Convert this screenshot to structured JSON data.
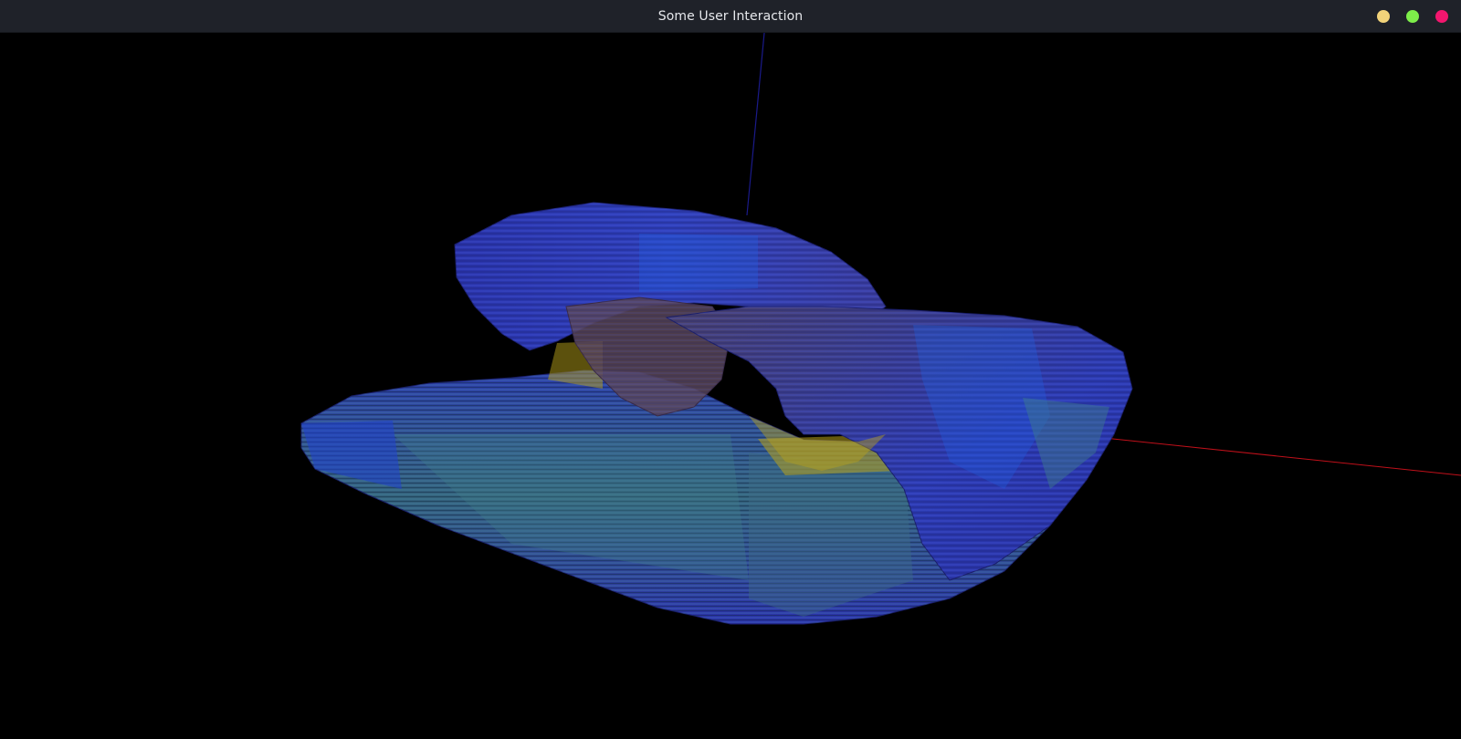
{
  "window": {
    "title": "Some User Interaction",
    "controls": {
      "minimize": {
        "color": "#f2d37a"
      },
      "maximize": {
        "color": "#7dee4a"
      },
      "close": {
        "color": "#f2166e"
      }
    }
  },
  "scene": {
    "background": "#000000",
    "object": "wireframe-3d-mesh",
    "colors": {
      "mesh_blue": "#2a2fa8",
      "mesh_bright_blue": "#1f5fe0",
      "mesh_teal": "#3e7f8a",
      "mesh_brown": "#5a4658",
      "mesh_yellow": "#b8a21a",
      "axis_x": "#c0101a",
      "axis_z": "#1a1a8a"
    }
  }
}
